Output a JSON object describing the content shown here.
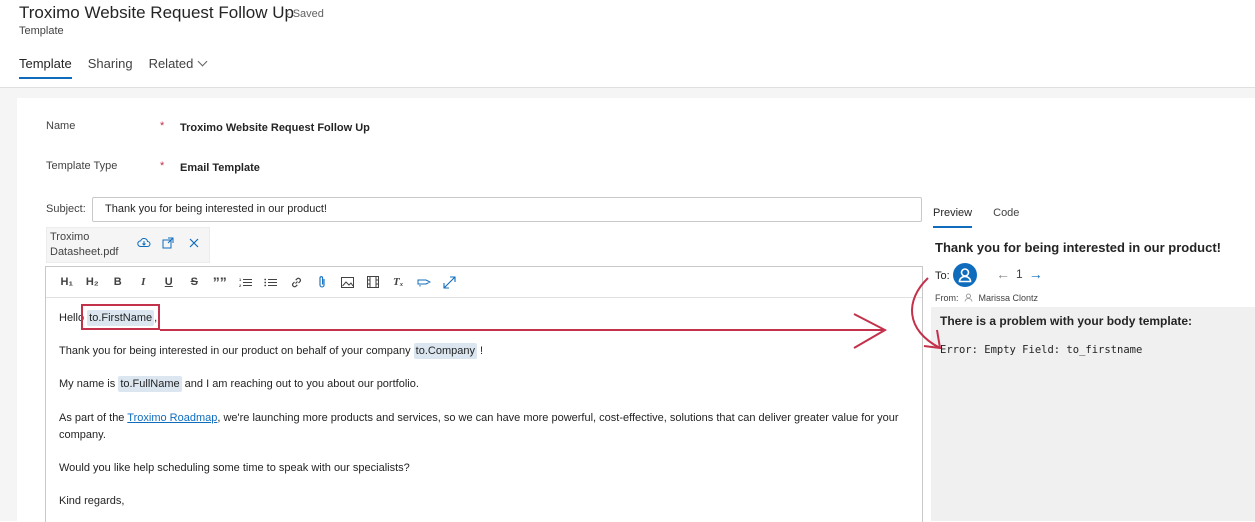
{
  "header": {
    "title": "Troximo Website Request Follow Up",
    "saved_status": "- Saved",
    "entity": "Template"
  },
  "tabs": [
    {
      "label": "Template",
      "active": true
    },
    {
      "label": "Sharing",
      "active": false
    },
    {
      "label": "Related",
      "active": false
    }
  ],
  "form": {
    "name_label": "Name",
    "name_value": "Troximo Website Request Follow Up",
    "type_label": "Template Type",
    "type_value": "Email Template",
    "required_marker": "*",
    "subject_label": "Subject:",
    "subject_value": "Thank you for being interested in our product!"
  },
  "attachment": {
    "line1": "Troximo",
    "line2": "Datasheet.pdf"
  },
  "toolbar": {
    "h1": "H₁",
    "h2": "H₂",
    "bold": "B",
    "italic": "I",
    "underline": "U",
    "strike": "S",
    "quote": "””",
    "clear_format": "Tₓ"
  },
  "body": {
    "greeting_prefix": "Hello",
    "token_firstname": "to.FirstName",
    "greeting_suffix": ",",
    "line2_prefix": "Thank you for being interested in our product on behalf of your company",
    "token_company": "to.Company",
    "line2_suffix": "!",
    "line3_prefix": "My name is",
    "token_fullname": "to.FullName",
    "line3_suffix": "and I am reaching out to you about our portfolio.",
    "line4_prefix": "As part of the",
    "line4_link": "Troximo Roadmap",
    "line4_suffix": ", we're launching more products and services, so we can have more powerful, cost-effective, solutions that can deliver greater value for your",
    "line4_cont": "company.",
    "line5": "Would you like help scheduling some time to speak with our specialists?",
    "line6": "Kind regards,"
  },
  "preview": {
    "tab_preview": "Preview",
    "tab_code": "Code",
    "subject": "Thank you for being interested in our product!",
    "to_label": "To:",
    "page": "1",
    "from_label": "From:",
    "from_name": "Marissa Clontz",
    "problem": "There is a problem with your body template:",
    "error": "Error: Empty Field: to_firstname"
  },
  "colors": {
    "accent": "#0f6cbd",
    "annotation": "#c4314b",
    "token_bg": "#dbe6f0"
  }
}
